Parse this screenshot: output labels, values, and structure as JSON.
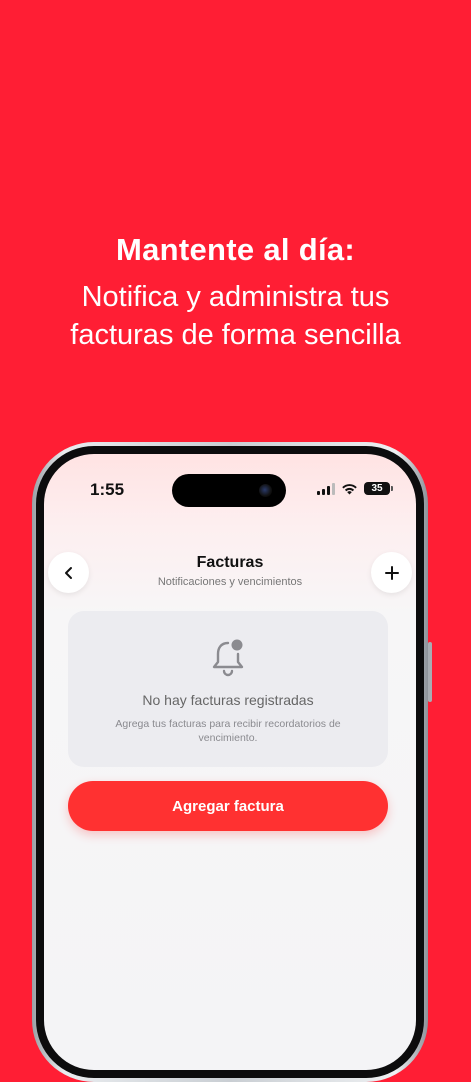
{
  "hero": {
    "title": "Mantente al día:",
    "subtitle": "Notifica y administra tus facturas de forma sencilla"
  },
  "status_bar": {
    "time": "1:55",
    "battery": "35"
  },
  "header": {
    "title": "Facturas",
    "subtitle": "Notificaciones y vencimientos",
    "back_icon": "chevron-left-icon",
    "add_icon": "plus-icon"
  },
  "empty_state": {
    "icon": "bell-badge-icon",
    "title": "No hay facturas registradas",
    "description": "Agrega tus facturas para recibir recordatorios de vencimiento."
  },
  "actions": {
    "add_invoice_label": "Agregar factura"
  },
  "colors": {
    "background": "#FF1E34",
    "primary_button": "#FF3131",
    "card": "#ECECF0"
  }
}
